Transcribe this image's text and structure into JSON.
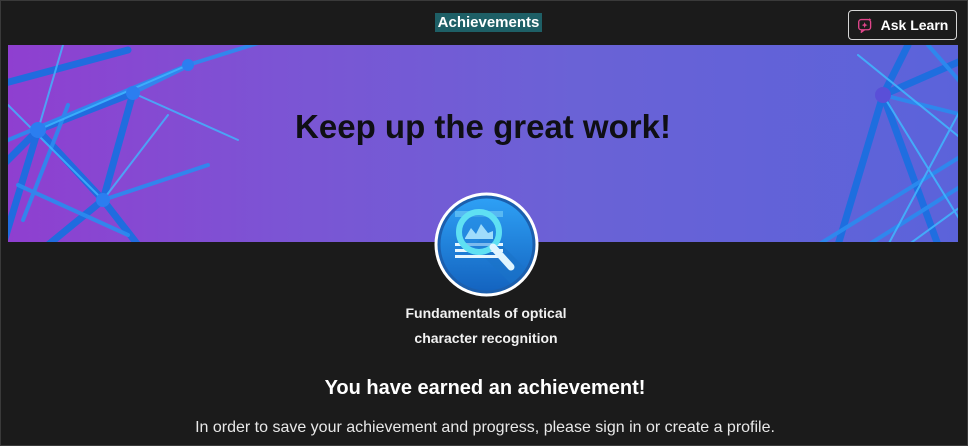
{
  "header": {
    "title": "Achievements",
    "ask_learn_label": "Ask Learn",
    "ask_learn_icon": "ask-learn-sparkle-icon"
  },
  "banner": {
    "heading": "Keep up the great work!",
    "gradient_colors": [
      "#8f3fd0",
      "#5b63da"
    ]
  },
  "badge": {
    "icon": "magnifier-badge-icon",
    "module_name": "Fundamentals of optical character recognition"
  },
  "main": {
    "earned_title": "You have earned an achievement!",
    "signin_message": "In order to save your achievement and progress, please sign in or create a profile."
  },
  "colors": {
    "background": "#1b1b1b",
    "title_highlight": "#1e5f66",
    "badge_blue": "#1c86e0"
  }
}
